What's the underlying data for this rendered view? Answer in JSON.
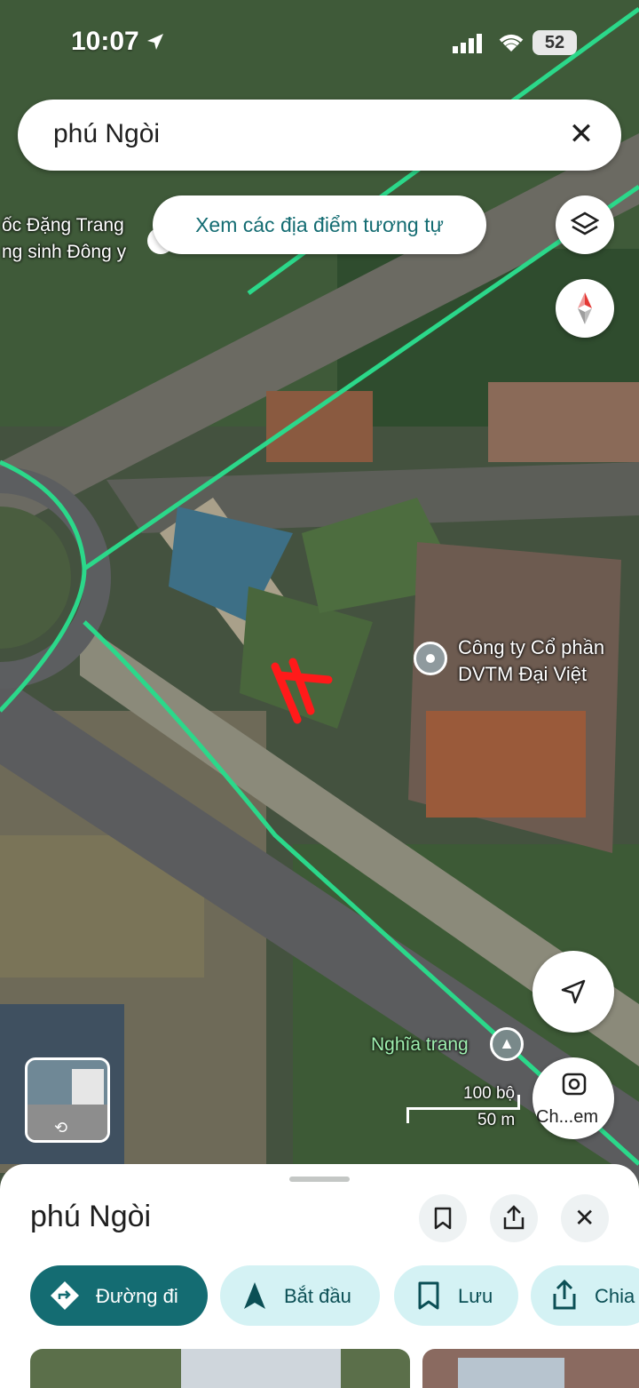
{
  "status_bar": {
    "time": "10:07",
    "battery": "52"
  },
  "search": {
    "query": "phú Ngòi"
  },
  "similar_chip": {
    "label": "Xem các địa điểm tương tự"
  },
  "map": {
    "labels": {
      "poi_left_1": "ốc Đặng Trang",
      "poi_left_2": "ng sinh Đông y",
      "company_1": "Công ty Cổ phần",
      "company_2": "DVTM Đại Việt",
      "cemetery": "Nghĩa trang"
    },
    "scale": {
      "imperial": "100 bộ",
      "metric": "50 m"
    },
    "street_view_label": "Ch...em"
  },
  "sheet": {
    "title": "phú Ngòi",
    "actions": [
      {
        "label": "Đường đi"
      },
      {
        "label": "Bắt đầu"
      },
      {
        "label": "Lưu"
      },
      {
        "label": "Chia"
      }
    ]
  },
  "colors": {
    "accent": "#146c72",
    "pill_bg": "#d4f2f4",
    "road_highlight": "#2bd88a",
    "marker": "#ff1a1a"
  }
}
